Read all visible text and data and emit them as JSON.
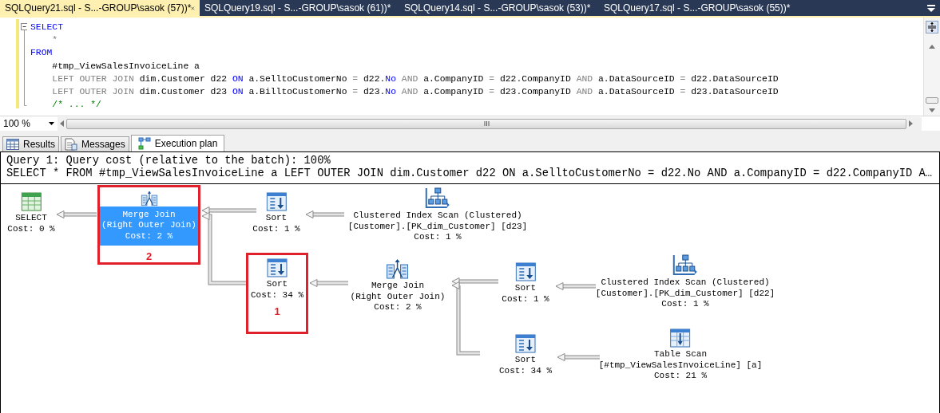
{
  "document_tabs": [
    {
      "label": "SQLQuery21.sql - S...-GROUP\\sasok (57))*",
      "selected": true
    },
    {
      "label": "SQLQuery19.sql - S...-GROUP\\sasok (61))*",
      "selected": false
    },
    {
      "label": "SQLQuery14.sql - S...-GROUP\\sasok (53))*",
      "selected": false
    },
    {
      "label": "SQLQuery17.sql - S...-GROUP\\sasok (55))*",
      "selected": false
    }
  ],
  "editor": {
    "lines": [
      [
        {
          "kind": "keyword",
          "text": "SELECT"
        }
      ],
      [
        {
          "kind": "operator",
          "text": "    *"
        }
      ],
      [
        {
          "kind": "keyword",
          "text": "FROM"
        }
      ],
      [
        {
          "kind": "plain",
          "text": "    #tmp_ViewSalesInvoiceLine a"
        }
      ],
      [
        {
          "kind": "operator",
          "text": "    LEFT OUTER JOIN"
        },
        {
          "kind": "plain",
          "text": " dim.Customer d22 "
        },
        {
          "kind": "keyword",
          "text": "ON"
        },
        {
          "kind": "plain",
          "text": " a.SelltoCustomerNo "
        },
        {
          "kind": "operator",
          "text": "="
        },
        {
          "kind": "plain",
          "text": " d22."
        },
        {
          "kind": "keyword",
          "text": "No"
        },
        {
          "kind": "operator",
          "text": " AND"
        },
        {
          "kind": "plain",
          "text": " a.CompanyID "
        },
        {
          "kind": "operator",
          "text": "="
        },
        {
          "kind": "plain",
          "text": " d22.CompanyID "
        },
        {
          "kind": "operator",
          "text": "AND"
        },
        {
          "kind": "plain",
          "text": " a.DataSourceID "
        },
        {
          "kind": "operator",
          "text": "="
        },
        {
          "kind": "plain",
          "text": " d22.DataSourceID"
        }
      ],
      [
        {
          "kind": "operator",
          "text": "    LEFT OUTER JOIN"
        },
        {
          "kind": "plain",
          "text": " dim.Customer d23 "
        },
        {
          "kind": "keyword",
          "text": "ON"
        },
        {
          "kind": "plain",
          "text": " a.BilltoCustomerNo "
        },
        {
          "kind": "operator",
          "text": "="
        },
        {
          "kind": "plain",
          "text": " d23."
        },
        {
          "kind": "keyword",
          "text": "No"
        },
        {
          "kind": "operator",
          "text": " AND"
        },
        {
          "kind": "plain",
          "text": " a.CompanyID "
        },
        {
          "kind": "operator",
          "text": "="
        },
        {
          "kind": "plain",
          "text": " d23.CompanyID "
        },
        {
          "kind": "operator",
          "text": "AND"
        },
        {
          "kind": "plain",
          "text": " a.DataSourceID "
        },
        {
          "kind": "operator",
          "text": "="
        },
        {
          "kind": "plain",
          "text": " d23.DataSourceID"
        }
      ],
      [
        {
          "kind": "comment",
          "text": "    /* ... */"
        }
      ]
    ]
  },
  "zoom": {
    "value": "100 %"
  },
  "result_tabs": [
    {
      "kind": "grid",
      "label": "Results",
      "selected": false
    },
    {
      "kind": "messages",
      "label": "Messages",
      "selected": false
    },
    {
      "kind": "plan",
      "label": "Execution plan",
      "selected": true
    }
  ],
  "plan": {
    "header": [
      "Query 1: Query cost (relative to the batch): 100%",
      "SELECT * FROM #tmp_ViewSalesInvoiceLine a LEFT OUTER JOIN dim.Customer d22 ON a.SelltoCustomerNo = d22.No AND a.CompanyID = d22.CompanyID A…"
    ],
    "nodes": [
      {
        "kind": "select",
        "lines": [
          "SELECT",
          "Cost: 0 %"
        ],
        "selected": false
      },
      {
        "kind": "merge_join",
        "lines": [
          "Merge Join",
          "(Right Outer Join)",
          "Cost: 2 %"
        ],
        "selected": true,
        "callout": "2"
      },
      {
        "kind": "sort",
        "lines": [
          "Sort",
          "Cost: 1 %"
        ],
        "selected": false
      },
      {
        "kind": "index_scan",
        "lines": [
          "Clustered Index Scan (Clustered)",
          "[Customer].[PK_dim_Customer] [d23]",
          "Cost: 1 %"
        ],
        "selected": false
      },
      {
        "kind": "sort",
        "lines": [
          "Sort",
          "Cost: 34 %"
        ],
        "selected": false,
        "callout": "1"
      },
      {
        "kind": "merge_join",
        "lines": [
          "Merge Join",
          "(Right Outer Join)",
          "Cost: 2 %"
        ],
        "selected": false
      },
      {
        "kind": "sort",
        "lines": [
          "Sort",
          "Cost: 1 %"
        ],
        "selected": false
      },
      {
        "kind": "index_scan",
        "lines": [
          "Clustered Index Scan (Clustered)",
          "[Customer].[PK_dim_Customer] [d22]",
          "Cost: 1 %"
        ],
        "selected": false
      },
      {
        "kind": "sort",
        "lines": [
          "Sort",
          "Cost: 34 %"
        ],
        "selected": false
      },
      {
        "kind": "table_scan",
        "lines": [
          "Table Scan",
          "[#tmp_ViewSalesInvoiceLine] [a]",
          "Cost: 21 %"
        ],
        "selected": false
      }
    ]
  }
}
